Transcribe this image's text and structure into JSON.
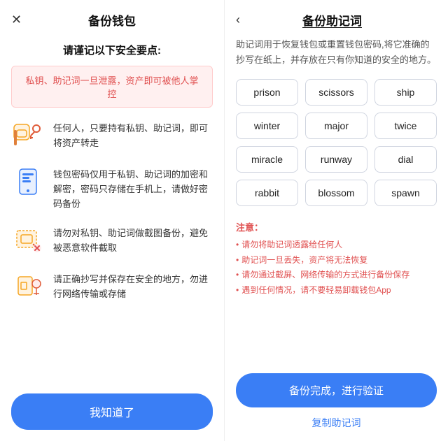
{
  "left": {
    "close_icon": "✕",
    "title": "备份钱包",
    "subtitle": "请谨记以下安全要点:",
    "warning": "私钥、助记词一旦泄露，资产即可被他人掌控",
    "security_items": [
      {
        "id": "key",
        "text": "任何人，只要持有私钥、助记词，即可将资产转走"
      },
      {
        "id": "phone",
        "text": "钱包密码仅用于私钥、助记词的加密和解密，密码只存储在手机上，请做好密码备份"
      },
      {
        "id": "screenshot",
        "text": "请勿对私钥、助记词做截图备份，避免被恶意软件截取"
      },
      {
        "id": "safe",
        "text": "请正确抄写并保存在安全的地方，勿进行网络传输或存储"
      }
    ],
    "button_label": "我知道了"
  },
  "right": {
    "back_icon": "‹",
    "title": "备份助记词",
    "description": "助记词用于恢复钱包或重置钱包密码,将它准确的抄写在纸上，并存放在只有你知道的安全的地方。",
    "words": [
      "prison",
      "scissors",
      "ship",
      "winter",
      "major",
      "twice",
      "miracle",
      "runway",
      "dial",
      "rabbit",
      "blossom",
      "spawn"
    ],
    "notes_title": "注意：",
    "notes": [
      "请勿将助记词透露给任何人",
      "助记词一旦丢失，资产将无法恢复",
      "请勿通过截屏、网络传输的方式进行备份保存",
      "遇到任何情况，请不要轻易卸载钱包App"
    ],
    "verify_button": "备份完成，进行验证",
    "copy_link": "复制助记词"
  }
}
